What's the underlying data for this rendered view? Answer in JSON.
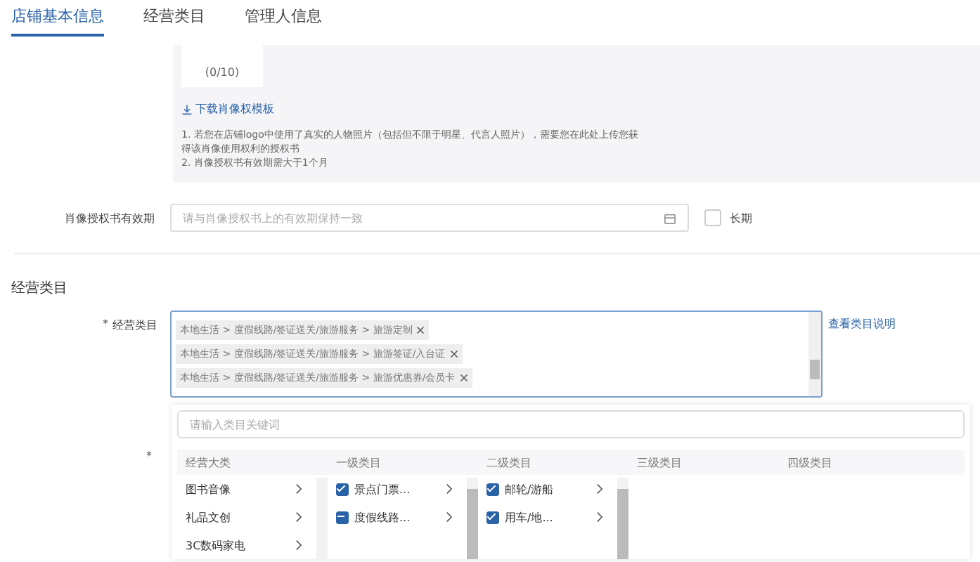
{
  "tabs": [
    {
      "label": "店铺基本信息",
      "selected": true
    },
    {
      "label": "经营类目",
      "selected": false
    },
    {
      "label": "管理人信息",
      "selected": false
    }
  ],
  "upload": {
    "count": "(0/10)",
    "download_link": "下载肖像权模板",
    "notes": [
      "1. 若您在店铺logo中使用了真实的人物照片（包括但不限于明星、代言人照片），需要您在此处上传您获得该肖像使用权利的授权书",
      "2. 肖像授权书有效期需大于1个月"
    ]
  },
  "validity": {
    "label": "肖像授权书有效期",
    "placeholder": "请与肖像授权书上的有效期保持一致",
    "long_term": {
      "label": "长期",
      "checked": false
    }
  },
  "section_title": "经营类目",
  "category_field": {
    "required_mark": "*",
    "label": "经营类目",
    "link": "查看类目说明",
    "tags": [
      "本地生活 > 度假线路/签证送关/旅游服务 > 旅游定制",
      "本地生活 > 度假线路/签证送关/旅游服务 > 旅游签证/入台证",
      "本地生活 > 度假线路/签证送关/旅游服务 > 旅游优惠券/会员卡"
    ]
  },
  "picker": {
    "required_mark": "*",
    "search_placeholder": "请输入类目关键词",
    "columns": [
      "经营大类",
      "一级类目",
      "二级类目",
      "三级类目",
      "四级类目"
    ],
    "major": [
      {
        "label": "图书音像"
      },
      {
        "label": "礼品文创"
      },
      {
        "label": "3C数码家电"
      }
    ],
    "level1": [
      {
        "label": "景点门票...",
        "checked": true,
        "indeterminate": false
      },
      {
        "label": "度假线路...",
        "checked": false,
        "indeterminate": true
      }
    ],
    "level2": [
      {
        "label": "邮轮/游船",
        "checked": true,
        "indeterminate": false
      },
      {
        "label": "用车/地...",
        "checked": true,
        "indeterminate": false
      }
    ]
  }
}
